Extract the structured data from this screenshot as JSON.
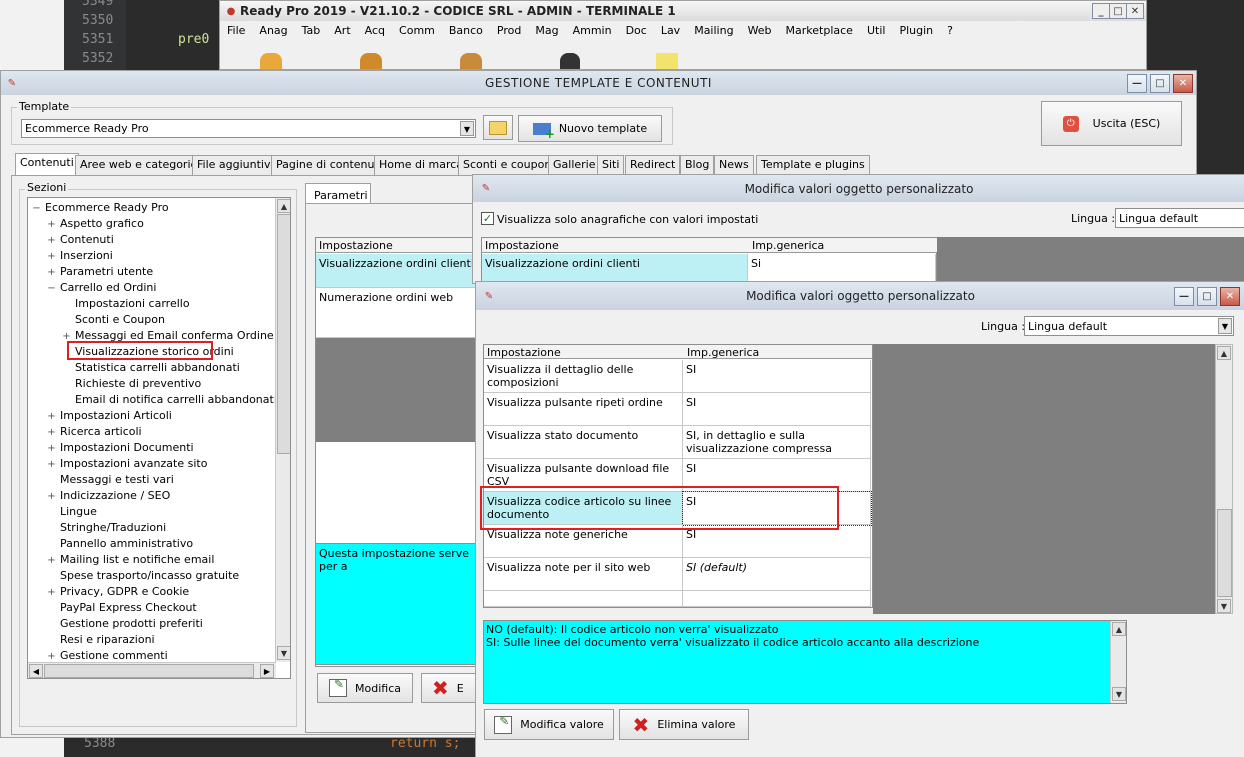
{
  "editor": {
    "lines_top": [
      "5349",
      "5350",
      "5351",
      "5352"
    ],
    "code_top": "pre0",
    "line_bottom": "5388",
    "code_bottom": "return s;"
  },
  "ready_window": {
    "title": "Ready Pro 2019 - V21.10.2 - CODICE SRL - ADMIN - TERMINALE 1",
    "menu": [
      "File",
      "Anag",
      "Tab",
      "Art",
      "Acq",
      "Comm",
      "Banco",
      "Prod",
      "Mag",
      "Ammin",
      "Doc",
      "Lav",
      "Mailing",
      "Web",
      "Marketplace",
      "Util",
      "Plugin",
      "?"
    ]
  },
  "gestione": {
    "title": "GESTIONE TEMPLATE E CONTENUTI",
    "template_label": "Template",
    "template_value": "Ecommerce Ready Pro",
    "new_template": "Nuovo template",
    "exit": "Uscita (ESC)",
    "tabs": [
      "Contenuti",
      "Aree web e categorie",
      "File aggiuntivi",
      "Pagine di contenuti",
      "Home di marca",
      "Sconti e coupon",
      "Gallerie",
      "Siti",
      "Redirect",
      "Blog",
      "News",
      "Template e plugins"
    ],
    "sections_label": "Sezioni",
    "tree": [
      {
        "label": "Ecommerce Ready Pro",
        "level": 0,
        "sign": "−"
      },
      {
        "label": "Aspetto grafico",
        "level": 1,
        "sign": "+"
      },
      {
        "label": "Contenuti",
        "level": 1,
        "sign": "+"
      },
      {
        "label": "Inserzioni",
        "level": 1,
        "sign": "+"
      },
      {
        "label": "Parametri utente",
        "level": 1,
        "sign": "+"
      },
      {
        "label": "Carrello ed Ordini",
        "level": 1,
        "sign": "−"
      },
      {
        "label": "Impostazioni carrello",
        "level": 2,
        "sign": ""
      },
      {
        "label": "Sconti e Coupon",
        "level": 2,
        "sign": ""
      },
      {
        "label": "Messaggi ed Email conferma Ordine",
        "level": 2,
        "sign": "+"
      },
      {
        "label": "Visualizzazione storico ordini",
        "level": 2,
        "sign": "",
        "selected": true
      },
      {
        "label": "Statistica carrelli abbandonati",
        "level": 2,
        "sign": ""
      },
      {
        "label": "Richieste di preventivo",
        "level": 2,
        "sign": ""
      },
      {
        "label": "Email di notifica carrelli abbandonati",
        "level": 2,
        "sign": ""
      },
      {
        "label": "Impostazioni Articoli",
        "level": 1,
        "sign": "+"
      },
      {
        "label": "Ricerca articoli",
        "level": 1,
        "sign": "+"
      },
      {
        "label": "Impostazioni Documenti",
        "level": 1,
        "sign": "+"
      },
      {
        "label": "Impostazioni avanzate sito",
        "level": 1,
        "sign": "+"
      },
      {
        "label": "Messaggi e testi vari",
        "level": 1,
        "sign": ""
      },
      {
        "label": "Indicizzazione / SEO",
        "level": 1,
        "sign": "+"
      },
      {
        "label": "Lingue",
        "level": 1,
        "sign": ""
      },
      {
        "label": "Stringhe/Traduzioni",
        "level": 1,
        "sign": ""
      },
      {
        "label": "Pannello amministrativo",
        "level": 1,
        "sign": ""
      },
      {
        "label": "Mailing list e notifiche email",
        "level": 1,
        "sign": "+"
      },
      {
        "label": "Spese trasporto/incasso gratuite",
        "level": 1,
        "sign": ""
      },
      {
        "label": "Privacy, GDPR e Cookie",
        "level": 1,
        "sign": "+"
      },
      {
        "label": "PayPal Express Checkout",
        "level": 1,
        "sign": ""
      },
      {
        "label": "Gestione prodotti preferiti",
        "level": 1,
        "sign": ""
      },
      {
        "label": "Resi e riparazioni",
        "level": 1,
        "sign": ""
      },
      {
        "label": "Gestione commenti",
        "level": 1,
        "sign": "+"
      }
    ],
    "params_tab": "Parametri",
    "grid_header": "Impostazione",
    "rows": [
      "Visualizzazione ordini clienti",
      "Numerazione ordini web"
    ],
    "description": "Questa impostazione serve per a",
    "modifica": "Modifica",
    "elimina_partial": "E"
  },
  "modal1": {
    "title": "Modifica valori oggetto personalizzato",
    "checkbox_label": "Visualizza solo anagrafiche con valori impostati",
    "lingua_label": "Lingua :",
    "lingua_value": "Lingua default",
    "col1": "Impostazione",
    "col2": "Imp.generica",
    "row_label": "Visualizzazione ordini clienti",
    "row_value": "Si"
  },
  "modal2": {
    "title": "Modifica valori oggetto personalizzato",
    "lingua_label": "Lingua :",
    "lingua_value": "Lingua default",
    "col1": "Impostazione",
    "col2": "Imp.generica",
    "rows": [
      {
        "label": "Visualizza il dettaglio delle composizioni",
        "value": "SI"
      },
      {
        "label": "Visualizza pulsante ripeti ordine",
        "value": "SI"
      },
      {
        "label": "Visualizza stato documento",
        "value": "SI, in dettaglio e sulla visualizzazione compressa"
      },
      {
        "label": "Visualizza pulsante download file CSV",
        "value": "SI"
      },
      {
        "label": "Visualizza codice articolo su linee documento",
        "value": "SI"
      },
      {
        "label": "Visualizza note generiche",
        "value": "SI"
      },
      {
        "label": "Visualizza note per il sito web",
        "value": "SI (default)"
      }
    ],
    "desc_line1": "NO (default): Il codice articolo non verra' visualizzato",
    "desc_line2": "SI: Sulle linee del documento verra' visualizzato il codice articolo accanto alla descrizione",
    "modifica_valore": "Modifica valore",
    "elimina_valore": "Elimina valore"
  },
  "colors": {
    "cyan": "#00ffff",
    "highlight": "#bdf0f4",
    "annotation": "#e02020"
  }
}
